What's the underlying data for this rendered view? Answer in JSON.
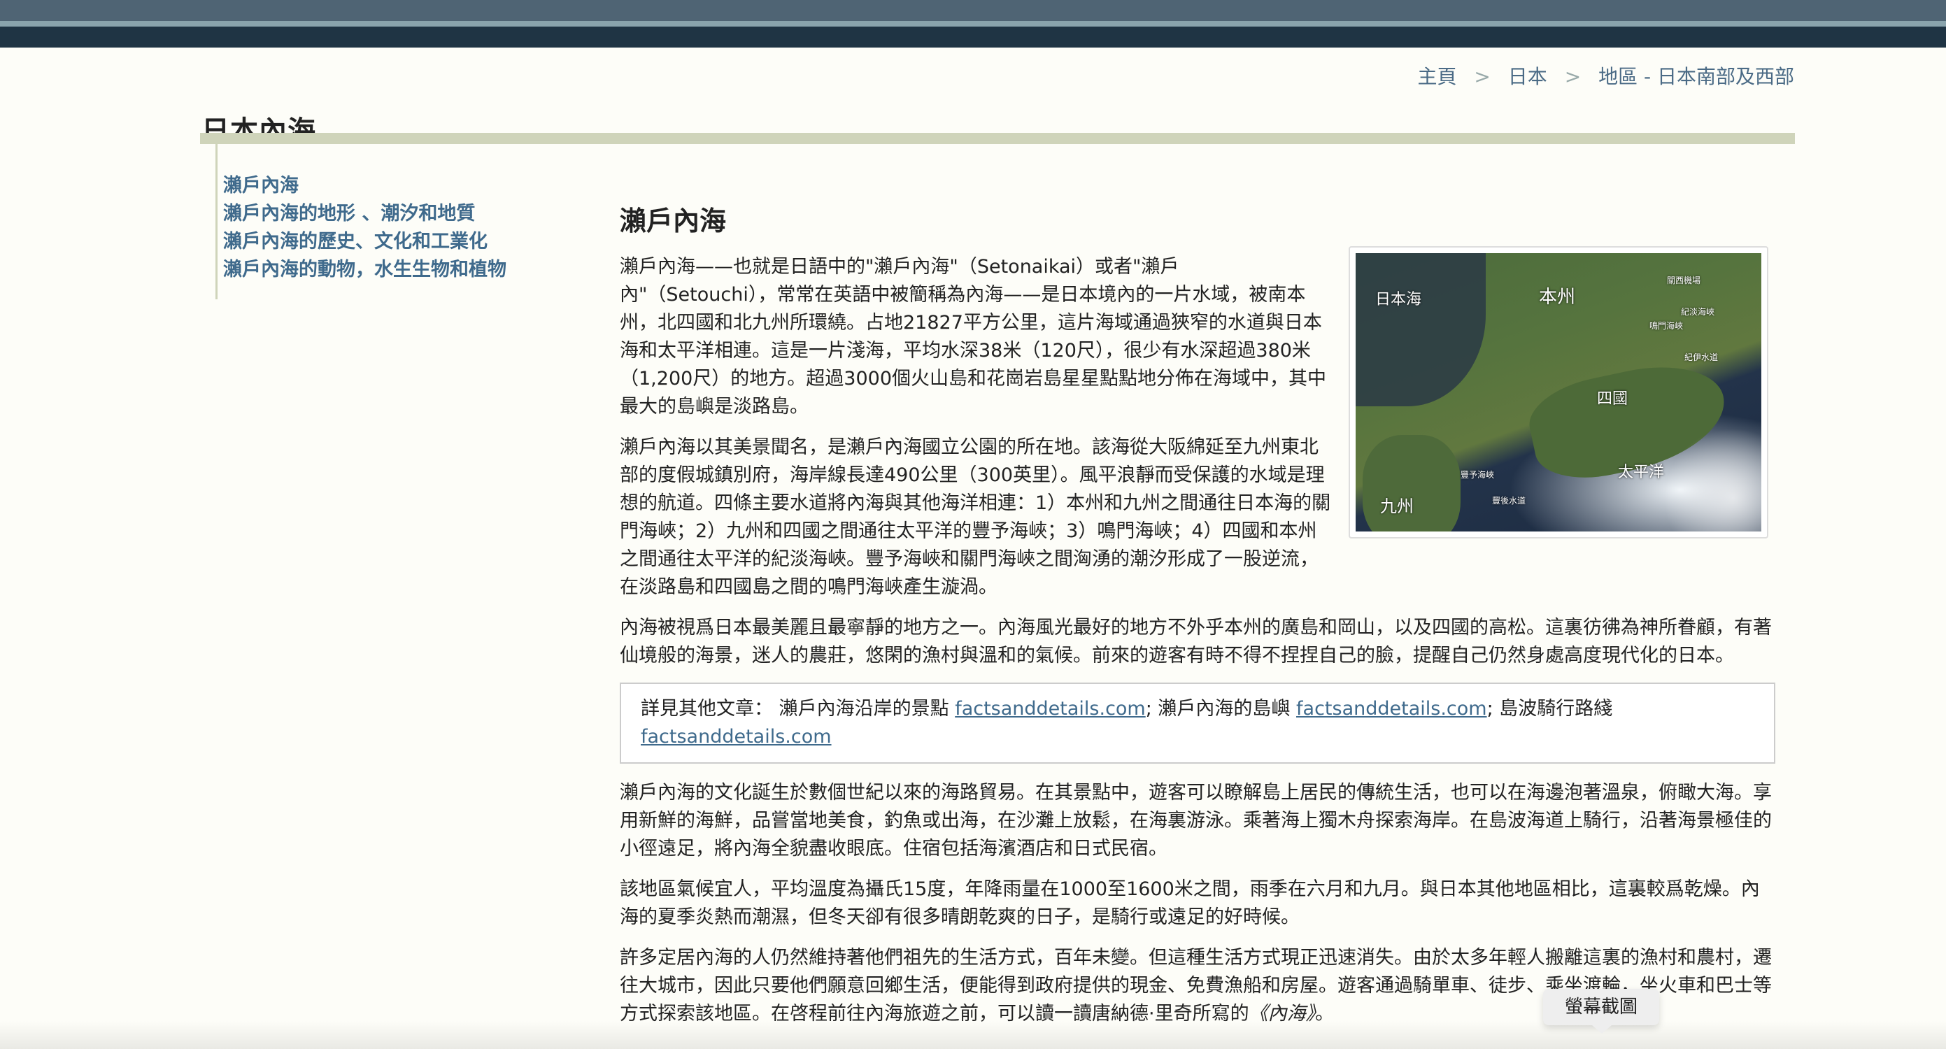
{
  "breadcrumb": {
    "home": "主頁",
    "sep": ">",
    "japan": "日本",
    "region": "地區 - 日本南部及西部"
  },
  "page_title": "日本內海",
  "sidenav": {
    "items": [
      {
        "label": "瀨戶內海"
      },
      {
        "label": "瀨戶內海的地形 、潮汐和地質"
      },
      {
        "label": "瀨戶內海的歷史、文化和工業化"
      },
      {
        "label": "瀨戶內海的動物，水生生物和植物"
      }
    ]
  },
  "section_title": "瀨戶內海",
  "paragraphs": {
    "p1": "瀨戶內海——也就是日語中的\"瀨戶內海\"（Setonaikai）或者\"瀨戶內\"（Setouchi），常常在英語中被簡稱為內海——是日本境內的一片水域，被南本州，北四國和北九州所環繞。占地21827平方公里，這片海域通過狹窄的水道與日本海和太平洋相連。這是一片淺海，平均水深38米（120尺），很少有水深超過380米（1,200尺）的地方。超過3000個火山島和花崗岩島星星點點地分佈在海域中，其中最大的島嶼是淡路島。",
    "p2": "瀨戶內海以其美景聞名，是瀨戶內海國立公園的所在地。該海從大阪綿延至九州東北部的度假城鎮別府，海岸線長達490公里（300英里）。風平浪靜而受保護的水域是理想的航道。四條主要水道將內海與其他海洋相連：1）本州和九州之間通往日本海的關門海峽；2）九州和四國之間通往太平洋的豐予海峽；3）鳴門海峽；4）四國和本州之間通往太平洋的紀淡海峽。豐予海峽和關門海峽之間洶湧的潮汐形成了一股逆流，在淡路島和四國島之間的鳴門海峽產生漩渦。",
    "p3": "內海被視爲日本最美麗且最寧靜的地方之一。內海風光最好的地方不外乎本州的廣島和岡山，以及四國的高松。這裏彷彿為神所眷顧，有著仙境般的海景，迷人的農莊，悠閑的漁村與溫和的氣候。前來的遊客有時不得不捏捏自己的臉，提醒自己仍然身處高度現代化的日本。",
    "p4": "瀨戶內海的文化誕生於數個世紀以來的海路貿易。在其景點中，遊客可以瞭解島上居民的傳統生活，也可以在海邊泡著溫泉，俯瞰大海。享用新鮮的海鮮，品嘗當地美食，釣魚或出海，在沙灘上放鬆，在海裏游泳。乘著海上獨木舟探索海岸。在島波海道上騎行，沿著海景極佳的小徑遠足，將內海全貌盡收眼底。住宿包括海濱酒店和日式民宿。",
    "p5": "該地區氣候宜人，平均溫度為攝氏15度，年降雨量在1000至1600米之間，雨季在六月和九月。與日本其他地區相比，這裏較爲乾燥。內海的夏季炎熱而潮濕，但冬天卻有很多晴朗乾爽的日子，是騎行或遠足的好時候。",
    "p6_start": "許多定居內海的人仍然維持著他們祖先的生活方式，百年未變。但這種生活方式現正迅速消失。由於太多年輕人搬離這裏的漁村和農村，遷往大城市，因此只要他們願意回鄉生活，便能得到政府提供的現金、免費漁船和房屋。遊客通過騎單車、徒步、乘坐渡輪，坐火車和巴士等方式探索該地區。在啓程前往內海旅遊之前，可以讀一讀唐納德·里奇所寫的",
    "p6_book": "《內海》",
    "p6_end": "。"
  },
  "see_also": {
    "prefix": "詳見其他文章： 瀨戶內海沿岸的景點",
    "link1": "factsanddetails.com",
    "mid1": "; 瀨戶內海的島嶼",
    "link2": "factsanddetails.com",
    "mid2": "; 島波騎行路綫",
    "link3": "factsanddetails.com"
  },
  "map": {
    "labels": {
      "sea_of_japan": "日本海",
      "honshu": "本州",
      "shikoku": "四國",
      "pacific": "太平洋",
      "kyushu": "九州",
      "small1": "關西機場",
      "small2": "紀淡海峽",
      "small3": "鳴門海峽",
      "small4": "紀伊水道",
      "small5": "豐予海峽",
      "small6": "豐後水道"
    }
  },
  "tooltip": "螢幕截圖",
  "colors": {
    "link": "#3f6a8c",
    "title_rule": "#cfd4ba",
    "header_dark": "#1f3444"
  }
}
